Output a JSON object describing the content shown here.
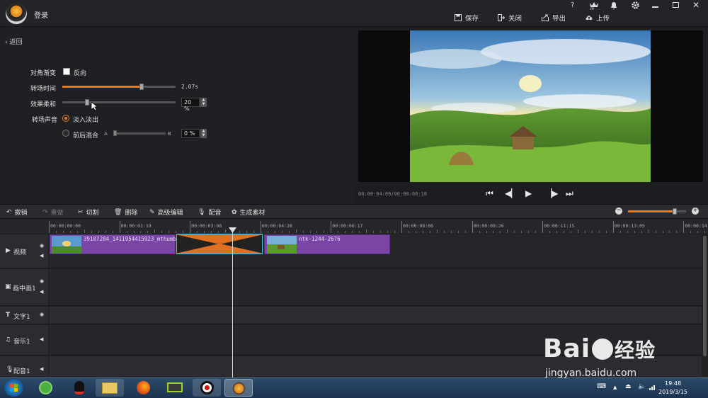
{
  "titlebar": {
    "login": "登录",
    "actions": [
      "保存",
      "关闭",
      "导出",
      "上传"
    ],
    "vip": "VIP",
    "help": "?"
  },
  "panel": {
    "back": "返回",
    "diagonal_label": "对角渐变",
    "reverse_label": "反向",
    "reverse_checked": false,
    "duration_label": "转场时间",
    "duration_value": "2.07s",
    "duration_fraction": 0.7,
    "softness_label": "效果柔和",
    "softness_value": "20 %",
    "softness_fraction": 0.2,
    "sound_label": "转场声音",
    "fade_label": "淡入淡出",
    "mix_label": "前后混合",
    "mix_a": "A",
    "mix_b": "B",
    "mix_value": "0 %",
    "mix_fraction": 0.0
  },
  "preview": {
    "timecode": "00:00:04:09/00:00:08:18"
  },
  "toolbar": {
    "undo": "撤销",
    "redo": "重做",
    "cut": "切割",
    "delete": "删除",
    "advanced": "高级编辑",
    "dub": "配音",
    "generate": "生成素材",
    "zoom_fraction": 0.8
  },
  "ruler": {
    "ticks": [
      "00:00:00:00",
      "00:00:01:19",
      "00:00:03:08",
      "00:00:04:28",
      "00:00:06:17",
      "00:00:08:06",
      "00:00:09:26",
      "00:00:11:15",
      "00:00:13:05",
      "00:00:14:"
    ]
  },
  "tracks": {
    "video": "视频",
    "pip": "画中画1",
    "text": "文字1",
    "music": "音乐1",
    "dub": "配音1"
  },
  "clips": {
    "clip1": "39107284_1411954415923_mthumb",
    "clip2": "ntk-1244-2676"
  },
  "taskbar": {
    "time": "19:48",
    "date": "2019/3/15"
  },
  "watermark": {
    "line1": "Bai",
    "line1b": "经验",
    "line2": "jingyan.baidu.com"
  },
  "colors": {
    "accent": "#e87a1e",
    "clip": "#7b45a6",
    "transition": "#e07020"
  }
}
